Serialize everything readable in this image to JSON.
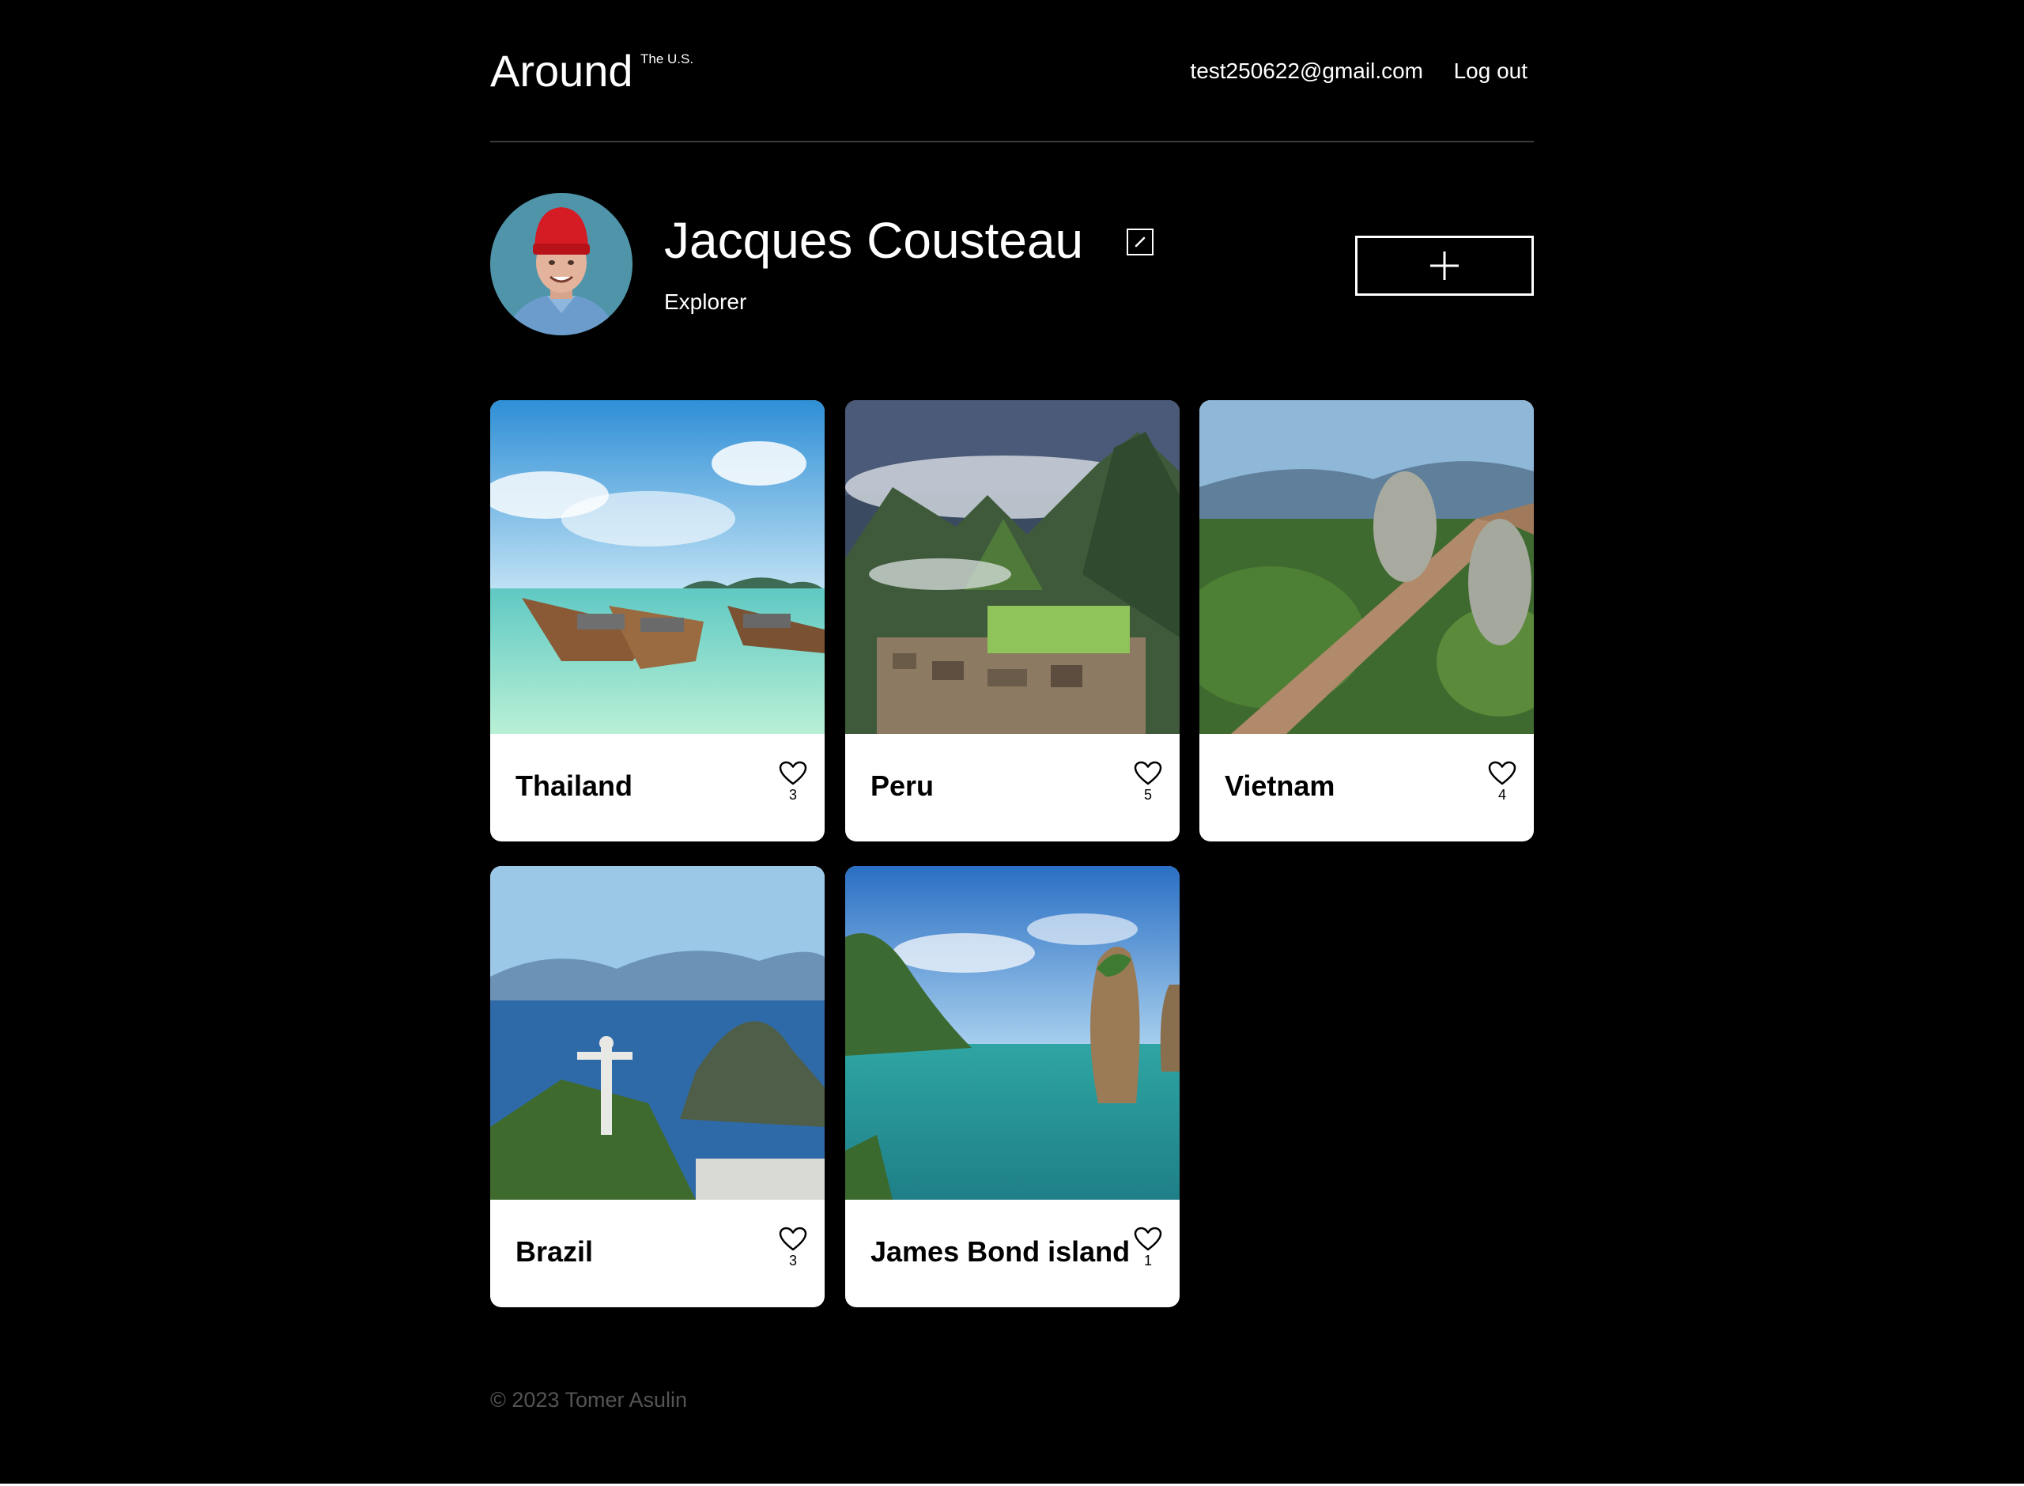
{
  "header": {
    "logo": "Around",
    "logo_sup": "The U.S.",
    "user_email": "test250622@gmail.com",
    "logout_label": "Log out"
  },
  "profile": {
    "name": "Jacques Cousteau",
    "description": "Explorer",
    "edit_icon": "pencil-icon",
    "add_icon": "plus-icon"
  },
  "cards": [
    {
      "title": "Thailand",
      "likes": "3",
      "image": "thailand-boats-photo"
    },
    {
      "title": "Peru",
      "likes": "5",
      "image": "machu-picchu-photo"
    },
    {
      "title": "Vietnam",
      "likes": "4",
      "image": "golden-bridge-photo"
    },
    {
      "title": "Brazil",
      "likes": "3",
      "image": "christ-the-redeemer-photo"
    },
    {
      "title": "James Bond island",
      "likes": "1",
      "image": "james-bond-island-photo"
    }
  ],
  "footer": {
    "copyright": "© 2023 Tomer Asulin"
  },
  "colors": {
    "background": "#000000",
    "text": "#ffffff",
    "card": "#ffffff",
    "footer_text": "#545454"
  }
}
